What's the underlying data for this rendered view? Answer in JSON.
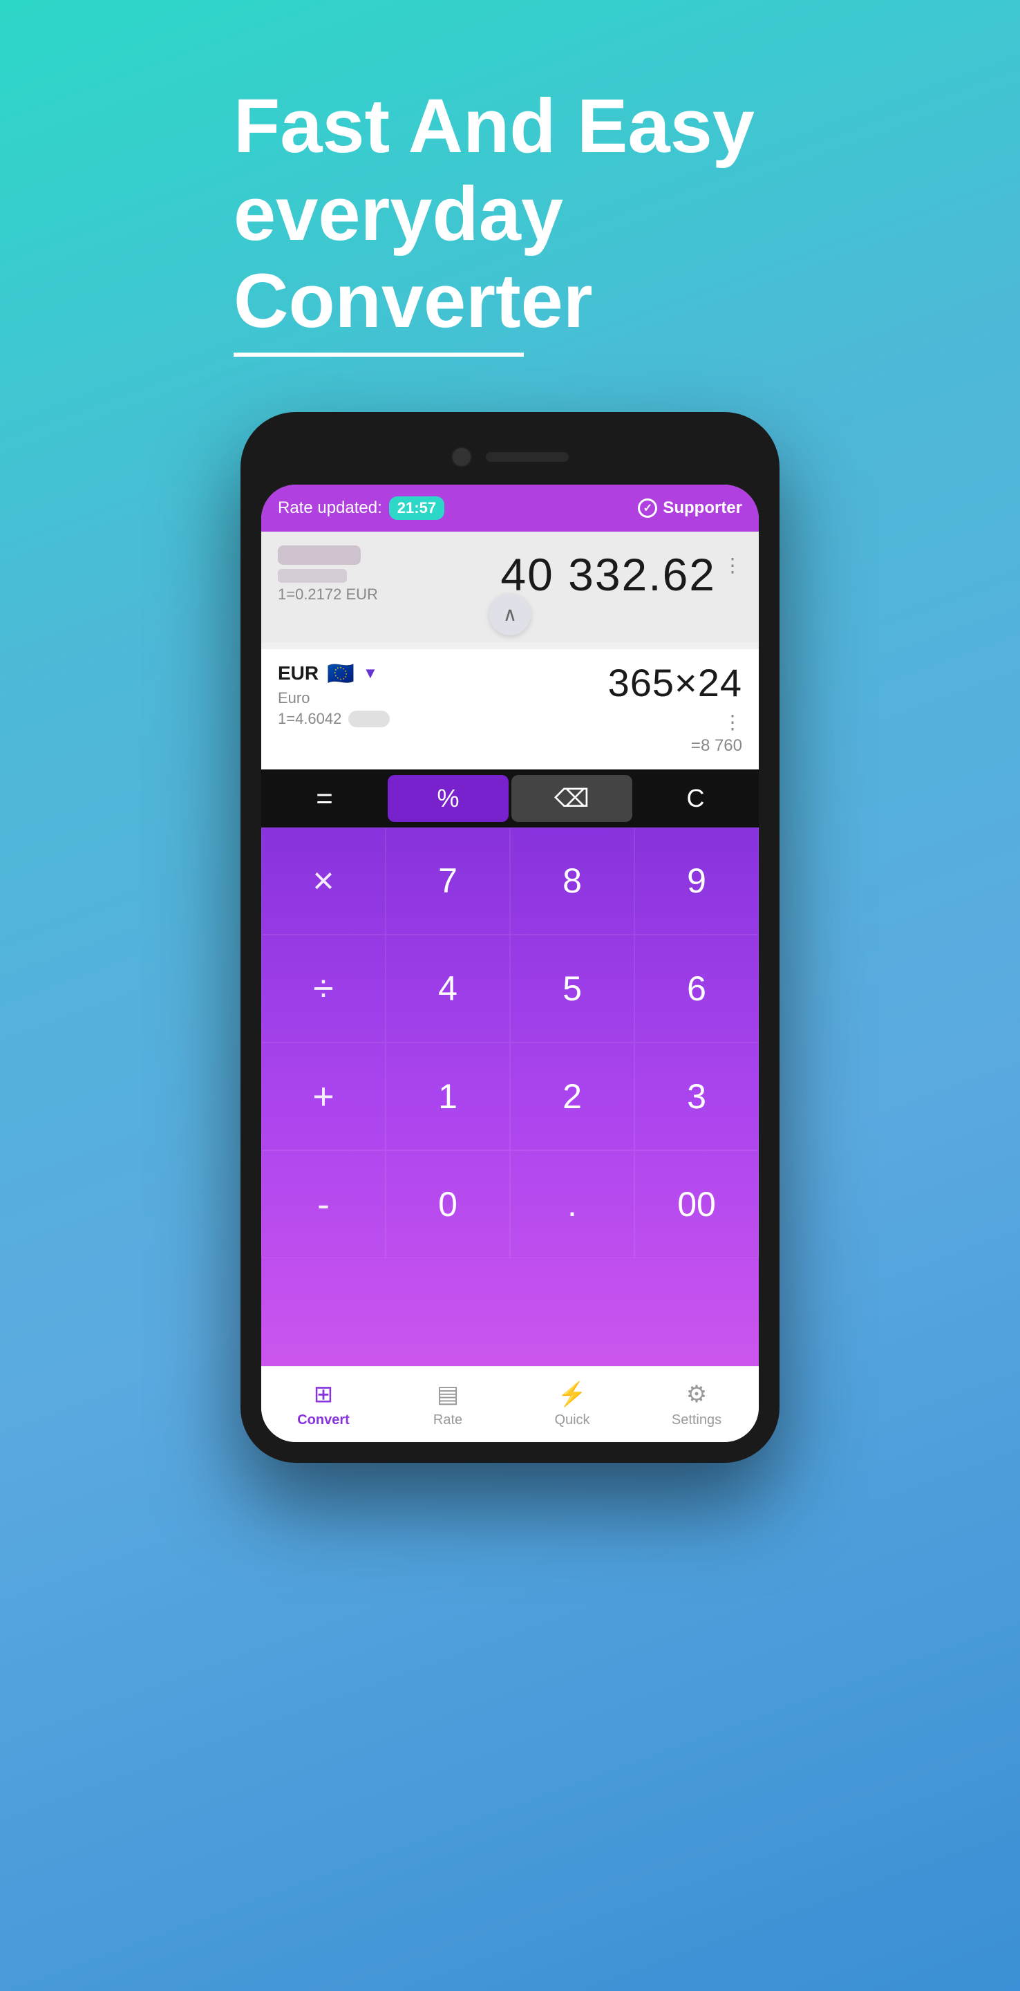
{
  "headline": {
    "line1": "Fast And Easy",
    "line2": "everyday",
    "line3": "Converter"
  },
  "status_bar": {
    "rate_updated_label": "Rate updated:",
    "time_badge": "21:57",
    "supporter_label": "Supporter"
  },
  "currency_row_1": {
    "amount": "40 332.62",
    "rate_text": "1=0.2172 EUR"
  },
  "currency_row_2": {
    "code": "EUR",
    "name": "Euro",
    "rate_text": "1=4.6042",
    "expr": "365×24",
    "result": "=8 760"
  },
  "calculator": {
    "ops": {
      "equals": "=",
      "percent": "%",
      "backspace": "⌫",
      "clear": "C"
    },
    "keys": [
      "×",
      "7",
      "8",
      "9",
      "÷",
      "4",
      "5",
      "6",
      "+",
      "1",
      "2",
      "3",
      "-",
      "0",
      ".",
      "00"
    ]
  },
  "bottom_nav": {
    "items": [
      {
        "label": "Convert",
        "icon": "⊞",
        "active": true
      },
      {
        "label": "Rate",
        "icon": "▦",
        "active": false
      },
      {
        "label": "Quick",
        "icon": "⚡",
        "active": false
      },
      {
        "label": "Settings",
        "icon": "⚙",
        "active": false
      }
    ]
  }
}
